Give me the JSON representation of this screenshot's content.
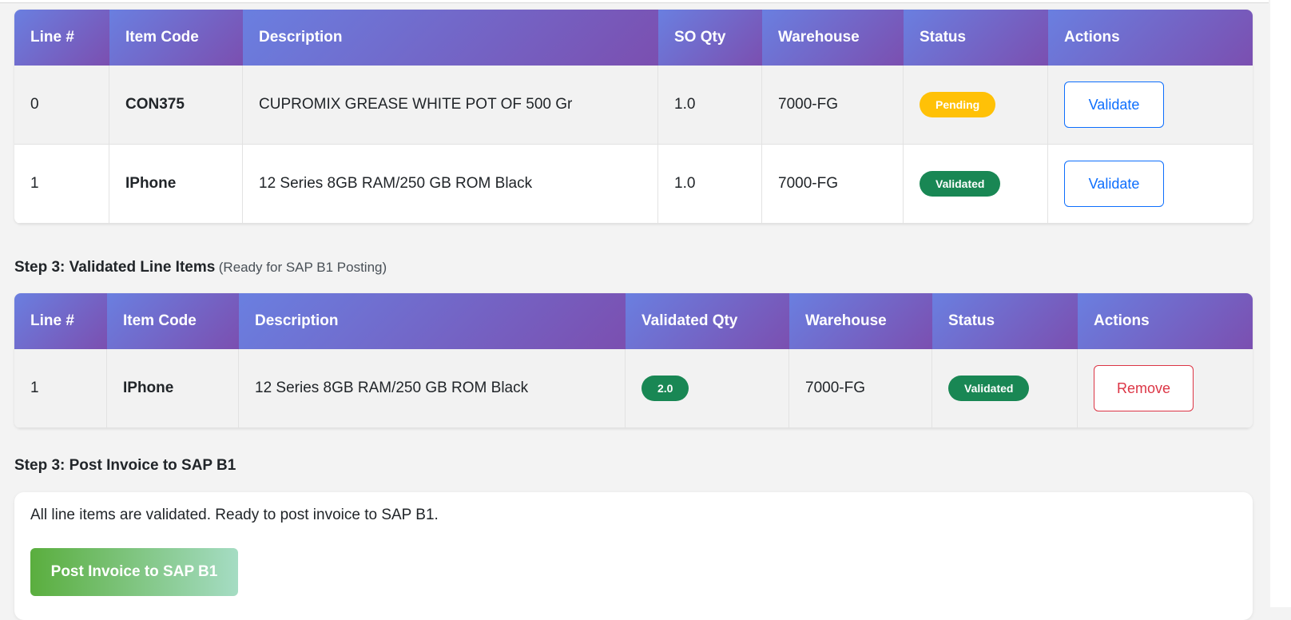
{
  "pending_table": {
    "headers": [
      "Line #",
      "Item Code",
      "Description",
      "SO Qty",
      "Warehouse",
      "Status",
      "Actions"
    ],
    "rows": [
      {
        "line": "0",
        "item_code": "CON375",
        "description": "CUPROMIX GREASE WHITE POT OF 500 Gr",
        "qty": "1.0",
        "warehouse": "7000-FG",
        "status": "Pending",
        "action": "Validate"
      },
      {
        "line": "1",
        "item_code": "IPhone",
        "description": "12 Series 8GB RAM/250 GB ROM Black",
        "qty": "1.0",
        "warehouse": "7000-FG",
        "status": "Validated",
        "action": "Validate"
      }
    ]
  },
  "validated_section": {
    "title": "Step 3: Validated Line Items",
    "subtitle": "(Ready for SAP B1 Posting)"
  },
  "validated_table": {
    "headers": [
      "Line #",
      "Item Code",
      "Description",
      "Validated Qty",
      "Warehouse",
      "Status",
      "Actions"
    ],
    "rows": [
      {
        "line": "1",
        "item_code": "IPhone",
        "description": "12 Series 8GB RAM/250 GB ROM Black",
        "qty": "2.0",
        "warehouse": "7000-FG",
        "status": "Validated",
        "action": "Remove"
      }
    ]
  },
  "post_section": {
    "title": "Step 3: Post Invoice to SAP B1",
    "message": "All line items are validated. Ready to post invoice to SAP B1.",
    "button_label": "Post Invoice to SAP B1"
  },
  "colors": {
    "header_gradient_start": "#6a7fe0",
    "header_gradient_end": "#7b4fb0",
    "pending": "#ffc107",
    "validated": "#198754",
    "validate_button": "#0d6efd",
    "remove_button": "#dc3545"
  }
}
